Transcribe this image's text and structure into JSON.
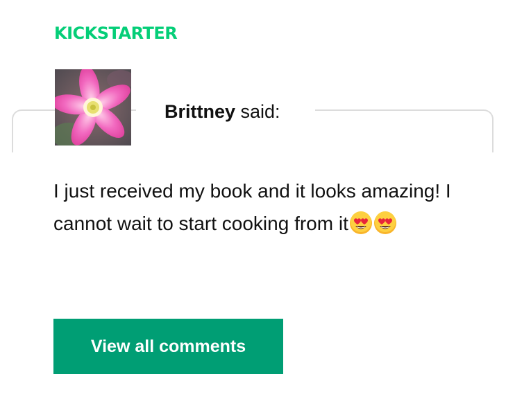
{
  "brand": {
    "logo_text": "KICKSTARTER",
    "color": "#05ce78"
  },
  "comment": {
    "author": "Brittney",
    "said_suffix": " said:",
    "text": "I just received my book and it looks amazing! I cannot wait to start cooking from it",
    "emojis": [
      "heart-eyes-emoji",
      "heart-eyes-emoji"
    ]
  },
  "actions": {
    "view_all_label": "View all comments",
    "button_color": "#009e74"
  }
}
